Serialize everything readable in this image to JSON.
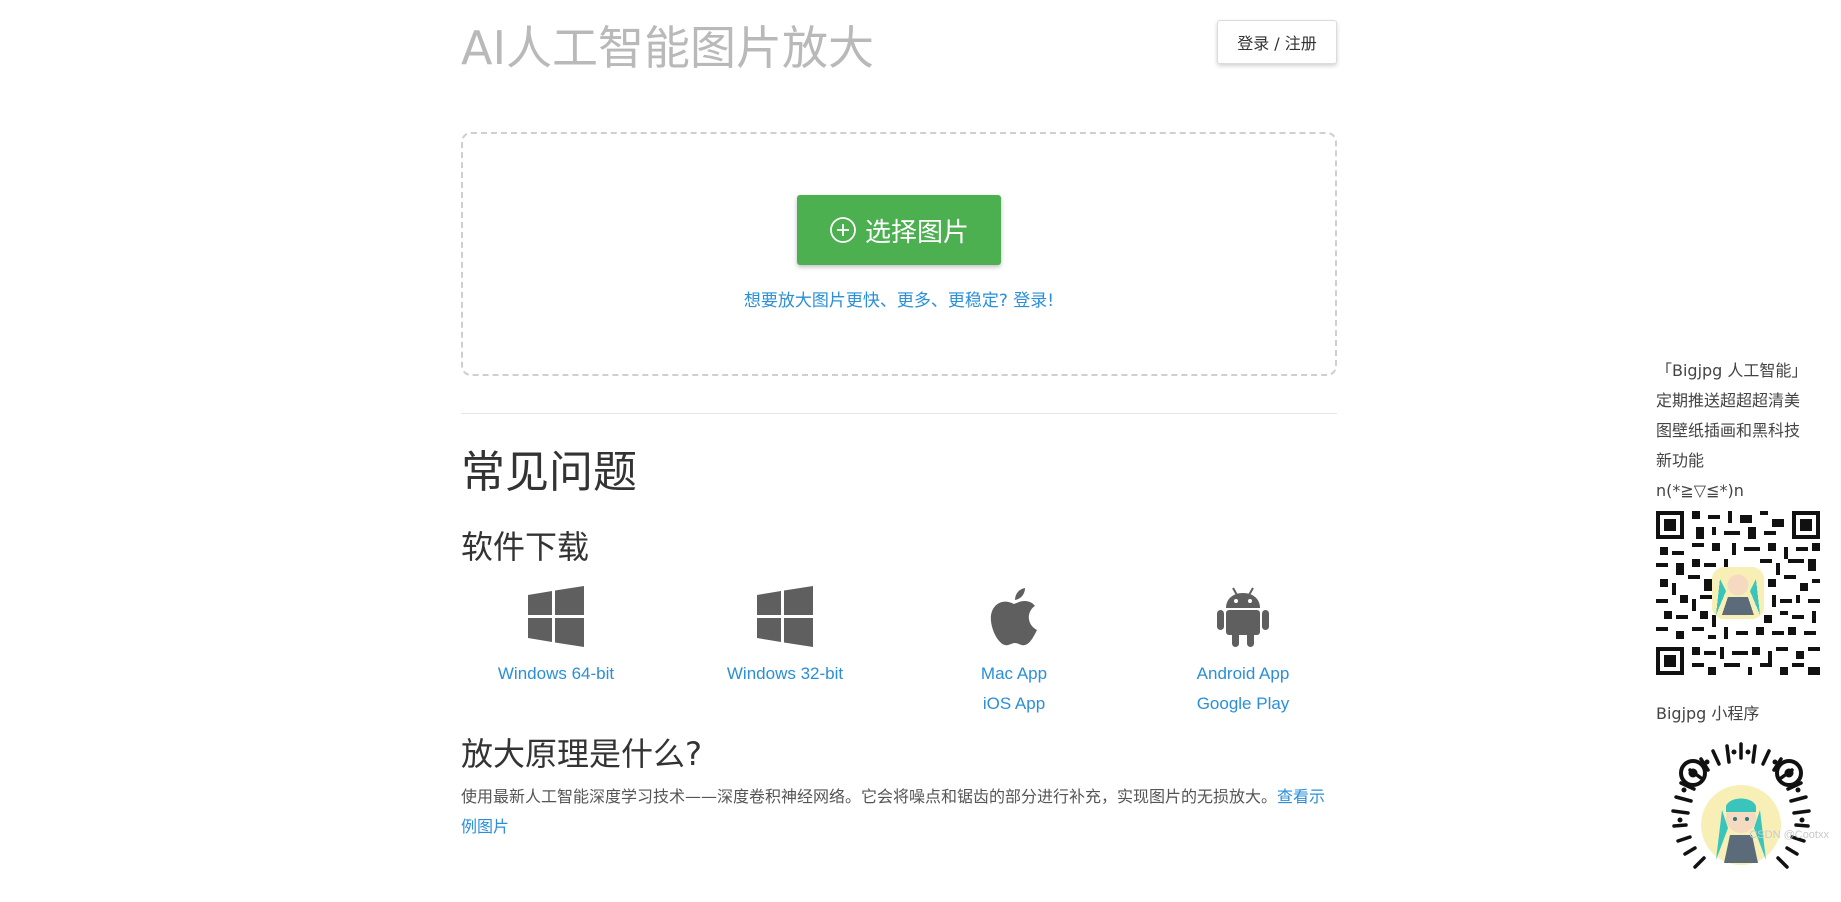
{
  "header": {
    "title": "AI人工智能图片放大",
    "login_label": "登录 / 注册"
  },
  "upload": {
    "button_label": "选择图片",
    "hint": "想要放大图片更快、更多、更稳定? 登录!"
  },
  "faq": {
    "title": "常见问题",
    "download_title": "软件下载",
    "downloads": [
      {
        "icon": "windows-icon",
        "links": [
          "Windows 64-bit"
        ]
      },
      {
        "icon": "windows-icon",
        "links": [
          "Windows 32-bit"
        ]
      },
      {
        "icon": "apple-icon",
        "links": [
          "Mac App",
          "iOS App"
        ]
      },
      {
        "icon": "android-icon",
        "links": [
          "Android App",
          "Google Play"
        ]
      }
    ],
    "principle_title": "放大原理是什么?",
    "principle_text": "使用最新人工智能深度学习技术——深度卷积神经网络。它会将噪点和锯齿的部分进行补充，实现图片的无损放大。",
    "principle_link": "查看示例图片"
  },
  "sidebar": {
    "promo_lines": [
      "「Bigjpg 人工智能」",
      "定期推送超超超清美",
      "图壁纸插画和黑科技",
      "新功能",
      "n(*≧▽≦*)n"
    ],
    "mini_program_label": "Bigjpg 小程序"
  },
  "watermark": "CSDN @Cootxx",
  "colors": {
    "accent_green": "#4caf50",
    "link_blue": "#2a8fd8",
    "title_gray": "#b9b9b9"
  }
}
